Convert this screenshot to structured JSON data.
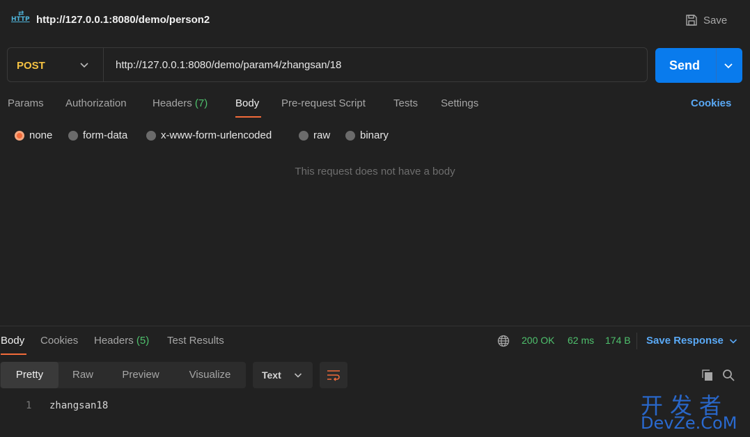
{
  "header": {
    "icon_label": "HTTP",
    "title": "http://127.0.0.1:8080/demo/person2",
    "save_label": "Save"
  },
  "request": {
    "method": "POST",
    "url": "http://127.0.0.1:8080/demo/param4/zhangsan/18",
    "send_label": "Send",
    "tabs": [
      {
        "label": "Params"
      },
      {
        "label": "Authorization"
      },
      {
        "label": "Headers",
        "count": "(7)"
      },
      {
        "label": "Body"
      },
      {
        "label": "Pre-request Script"
      },
      {
        "label": "Tests"
      },
      {
        "label": "Settings"
      }
    ],
    "active_tab": "Body",
    "cookies_label": "Cookies",
    "body_types": [
      "none",
      "form-data",
      "x-www-form-urlencoded",
      "raw",
      "binary"
    ],
    "selected_body_type": "none",
    "empty_message": "This request does not have a body"
  },
  "response": {
    "tabs": [
      {
        "label": "Body"
      },
      {
        "label": "Cookies"
      },
      {
        "label": "Headers",
        "count": "(5)"
      },
      {
        "label": "Test Results"
      }
    ],
    "active_tab": "Body",
    "status": "200 OK",
    "time": "62 ms",
    "size": "174 B",
    "save_response_label": "Save Response",
    "views": [
      "Pretty",
      "Raw",
      "Preview",
      "Visualize"
    ],
    "active_view": "Pretty",
    "format": "Text",
    "lines": [
      {
        "number": "1",
        "text": "zhangsan18"
      }
    ]
  },
  "watermark": {
    "line1": "开发者",
    "line2": "DevZe.CoM"
  },
  "colors": {
    "accent": "#f26b3a",
    "send": "#097bed",
    "link": "#5aa9f5",
    "success": "#4fc16d",
    "method": "#f5c242"
  }
}
